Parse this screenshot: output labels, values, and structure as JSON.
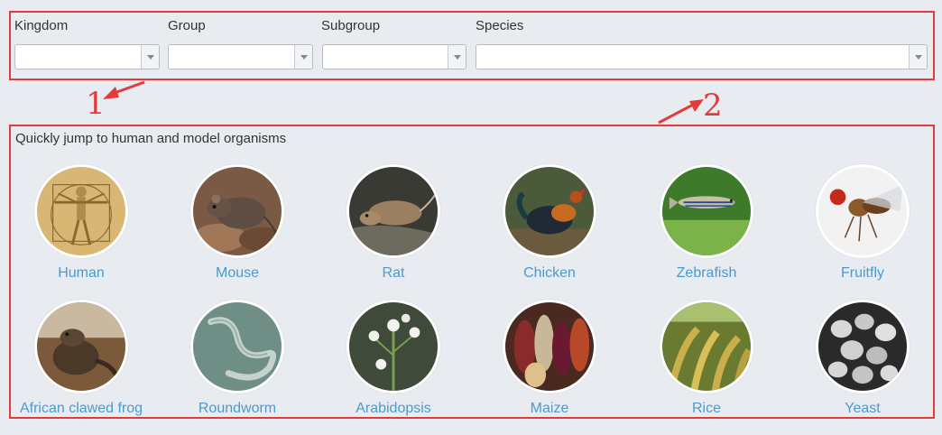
{
  "filters": {
    "kingdom_label": "Kingdom",
    "group_label": "Group",
    "subgroup_label": "Subgroup",
    "species_label": "Species",
    "kingdom_value": "",
    "group_value": "",
    "subgroup_value": "",
    "species_value": ""
  },
  "annotations": {
    "one": "1",
    "two": "2"
  },
  "organisms": {
    "title": "Quickly jump to human and model organisms",
    "items": [
      {
        "label": "Human"
      },
      {
        "label": "Mouse"
      },
      {
        "label": "Rat"
      },
      {
        "label": "Chicken"
      },
      {
        "label": "Zebrafish"
      },
      {
        "label": "Fruitfly"
      },
      {
        "label": "African clawed frog"
      },
      {
        "label": "Roundworm"
      },
      {
        "label": "Arabidopsis"
      },
      {
        "label": "Maize"
      },
      {
        "label": "Rice"
      },
      {
        "label": "Yeast"
      }
    ]
  },
  "colors": {
    "annotation": "#e23b3b",
    "link": "#4a9bd1",
    "background": "#e8ebef"
  }
}
